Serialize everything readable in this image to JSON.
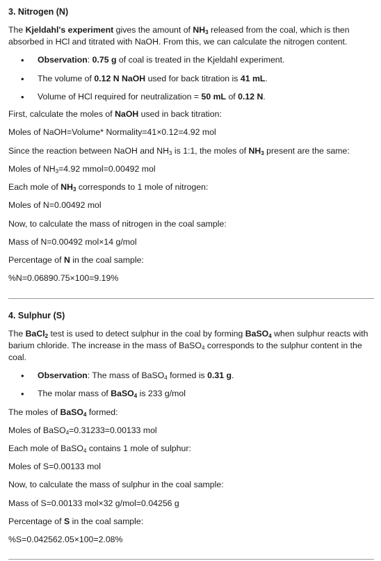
{
  "nitrogen": {
    "heading": "3. Nitrogen (N)",
    "intro_1": "The ",
    "intro_b1": "Kjeldahl's experiment",
    "intro_2": " gives the amount of ",
    "intro_b2": "NH",
    "intro_b2_sub": "3",
    "intro_3": " released from the coal, which is then",
    "intro_line2": "absorbed in HCl and titrated with NaOH. From this, we can calculate the nitrogen content.",
    "bullet1_b": "Observation",
    "bullet1_1": ": ",
    "bullet1_b2": "0.75 g",
    "bullet1_2": " of coal is treated in the Kjeldahl experiment.",
    "bullet2_1": "The volume of ",
    "bullet2_b": "0.12 N NaOH",
    "bullet2_2": " used for back titration is ",
    "bullet2_b2": "41 mL",
    "bullet2_3": ".",
    "bullet3_1": "Volume of HCl required for neutralization = ",
    "bullet3_b": "50 mL",
    "bullet3_2": " of ",
    "bullet3_b2": "0.12 N",
    "bullet3_3": ".",
    "l_first_1": "First, calculate the moles of ",
    "l_first_b": "NaOH",
    "l_first_2": " used in back titration:",
    "l_moles_naoh": "Moles of NaOH=Volume* Normality=41×0.12=4.92 mol",
    "l_since_1": "Since the reaction between NaOH and NH",
    "l_since_sub": "3",
    "l_since_2": " is 1:1, the moles of ",
    "l_since_b": "NH",
    "l_since_bsub": "3",
    "l_since_3": " present are the same:",
    "l_moles_nh3_1": "Moles of NH",
    "l_moles_nh3_sub": "3",
    "l_moles_nh3_2": "=4.92 mmol=0.00492 mol",
    "l_each_1": "Each mole of ",
    "l_each_b": "NH",
    "l_each_bsub": "3",
    "l_each_2": " corresponds to 1 mole of nitrogen:",
    "l_moles_n": "Moles of N=0.00492 mol",
    "l_now": "Now, to calculate the mass of nitrogen in the coal sample:",
    "l_mass_n": "Mass of N=0.00492 mol×14 g/mol",
    "l_pct_1": "Percentage of ",
    "l_pct_b": "N",
    "l_pct_2": " in the coal sample:",
    "l_pct_eq": "%N=0.06890.75×100=9.19%"
  },
  "sulphur": {
    "heading": "4. Sulphur (S)",
    "intro_1": "The ",
    "intro_b1": "BaCl",
    "intro_b1_sub": "2",
    "intro_2": " test is used to detect sulphur in the coal by forming ",
    "intro_b2": "BaSO",
    "intro_b2_sub": "4",
    "intro_3": " when sulphur reacts with",
    "intro_line2_1": "barium chloride. The increase in the mass of BaSO",
    "intro_line2_sub": "4",
    "intro_line2_2": " corresponds to the sulphur content in the",
    "intro_line3": "coal.",
    "bullet1_b": "Observation",
    "bullet1_1": ": The mass of BaSO",
    "bullet1_sub": "4",
    "bullet1_2": " formed is ",
    "bullet1_b2": "0.31 g",
    "bullet1_3": ".",
    "bullet2_1": "The molar mass of ",
    "bullet2_b": "BaSO",
    "bullet2_bsub": "4",
    "bullet2_2": " is 233 g/mol",
    "l_moles_1": "The moles of ",
    "l_moles_b": "BaSO",
    "l_moles_bsub": "4",
    "l_moles_2": " formed:",
    "l_moles_baso4_1": "Moles of BaSO",
    "l_moles_baso4_sub": "4",
    "l_moles_baso4_2": "=0.31233=0.00133 mol",
    "l_each_1": "Each mole of BaSO",
    "l_each_sub": "4",
    "l_each_2": " contains 1 mole of sulphur:",
    "l_moles_s": "Moles of S=0.00133 mol",
    "l_now": "Now, to calculate the mass of sulphur in the coal sample:",
    "l_mass_s": "Mass of S=0.00133 mol×32 g/mol=0.04256 g",
    "l_pct_1": "Percentage of ",
    "l_pct_b": "S",
    "l_pct_2": " in the coal sample:",
    "l_pct_eq": "%S=0.042562.05×100=2.08%"
  }
}
